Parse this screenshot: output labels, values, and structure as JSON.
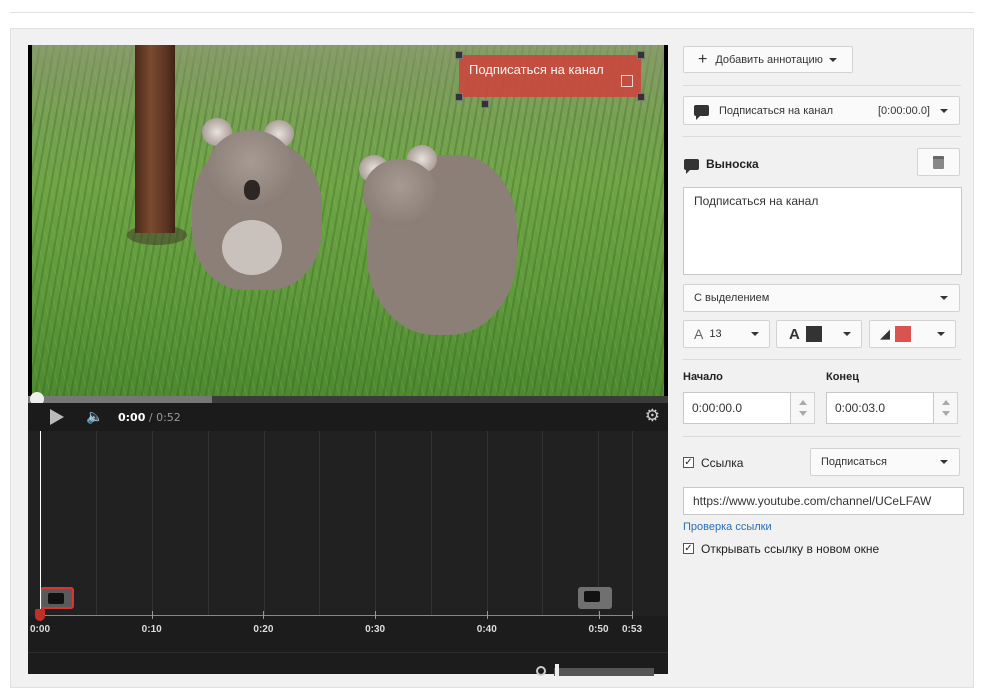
{
  "annotation_overlay": {
    "text": "Подписаться на канал"
  },
  "player": {
    "current_time": "0:00",
    "total_time": "/ 0:52",
    "progress_fraction": 0.0
  },
  "timeline": {
    "ticks": [
      {
        "label": "0:00",
        "sec": 0
      },
      {
        "label": "0:10",
        "sec": 10
      },
      {
        "label": "0:20",
        "sec": 20
      },
      {
        "label": "0:30",
        "sec": 30
      },
      {
        "label": "0:40",
        "sec": 40
      },
      {
        "label": "0:50",
        "sec": 50
      },
      {
        "label": "0:53",
        "sec": 53
      }
    ]
  },
  "panel": {
    "add_annotation": "Добавить аннотацию",
    "annotation_select": {
      "name": "Подписаться на канал",
      "time": "[0:00:00.0]"
    },
    "type_title": "Выноска",
    "text_value": "Подписаться на канал",
    "style_select": "С выделением",
    "font_size": "13",
    "text_color": "#333333",
    "bg_color": "#d9534f",
    "start_label": "Начало",
    "end_label": "Конец",
    "start_value": "0:00:00.0",
    "end_value": "0:00:03.0",
    "link_label": "Ссылка",
    "link_checked": true,
    "link_type": "Подписаться",
    "link_url": "https://www.youtube.com/channel/UCeLFAW",
    "check_link": "Проверка ссылки",
    "new_window_label": "Открывать ссылку в новом окне",
    "new_window_checked": true
  }
}
